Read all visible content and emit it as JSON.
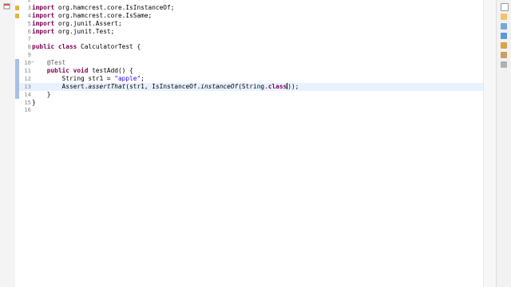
{
  "colors": {
    "keyword": "#7f0055",
    "string": "#2a00ff",
    "annotation": "#646464",
    "static_method": "#000000",
    "default": "#000000",
    "current_line": "#e8f2fe"
  },
  "editor": {
    "lines": [
      {
        "number": "2",
        "tokens": [
          {
            "t": "",
            "k": "default"
          }
        ]
      },
      {
        "number": "3",
        "tokens": [
          {
            "t": "import",
            "k": "keyword"
          },
          {
            "t": " org.hamcrest.core.IsInstanceOf;",
            "k": "default"
          }
        ]
      },
      {
        "number": "4",
        "tokens": [
          {
            "t": "import",
            "k": "keyword"
          },
          {
            "t": " org.hamcrest.core.IsSame;",
            "k": "default"
          }
        ]
      },
      {
        "number": "5",
        "tokens": [
          {
            "t": "import",
            "k": "keyword"
          },
          {
            "t": " org.junit.Assert;",
            "k": "default"
          }
        ]
      },
      {
        "number": "6",
        "tokens": [
          {
            "t": "import",
            "k": "keyword"
          },
          {
            "t": " org.junit.Test;",
            "k": "default"
          }
        ]
      },
      {
        "number": "7",
        "tokens": [
          {
            "t": "",
            "k": "default"
          }
        ]
      },
      {
        "number": "8",
        "tokens": [
          {
            "t": "public class",
            "k": "keyword"
          },
          {
            "t": " CalculatorTest {",
            "k": "default"
          }
        ]
      },
      {
        "number": "9",
        "tokens": [
          {
            "t": "",
            "k": "default"
          }
        ]
      },
      {
        "number": "10",
        "tokens": [
          {
            "t": "    ",
            "k": "default"
          },
          {
            "t": "@Test",
            "k": "annotation"
          }
        ]
      },
      {
        "number": "11",
        "tokens": [
          {
            "t": "    ",
            "k": "default"
          },
          {
            "t": "public void",
            "k": "keyword"
          },
          {
            "t": " testAdd() {",
            "k": "default"
          }
        ]
      },
      {
        "number": "12",
        "tokens": [
          {
            "t": "        String str1 = ",
            "k": "default"
          },
          {
            "t": "\"apple\"",
            "k": "string"
          },
          {
            "t": ";",
            "k": "default"
          }
        ]
      },
      {
        "number": "13",
        "tokens": [
          {
            "t": "        Assert.",
            "k": "default"
          },
          {
            "t": "assertThat",
            "k": "static_method"
          },
          {
            "t": "(str1, IsInstanceOf.",
            "k": "default"
          },
          {
            "t": "instanceOf",
            "k": "static_method"
          },
          {
            "t": "(String.",
            "k": "default"
          },
          {
            "t": "class",
            "k": "keyword"
          },
          {
            "t": "));",
            "k": "default"
          }
        ]
      },
      {
        "number": "14",
        "tokens": [
          {
            "t": "    }",
            "k": "default"
          }
        ]
      },
      {
        "number": "15",
        "tokens": [
          {
            "t": "}",
            "k": "default"
          }
        ]
      },
      {
        "number": "16",
        "tokens": [
          {
            "t": "",
            "k": "default"
          }
        ]
      }
    ]
  },
  "icons": {
    "left_rail": "restore-view-icon",
    "right_strip": [
      "restore-icon",
      "task-list-icon",
      "outline-icon",
      "console-icon",
      "problems-icon",
      "search-icon",
      "debug-icon"
    ]
  }
}
